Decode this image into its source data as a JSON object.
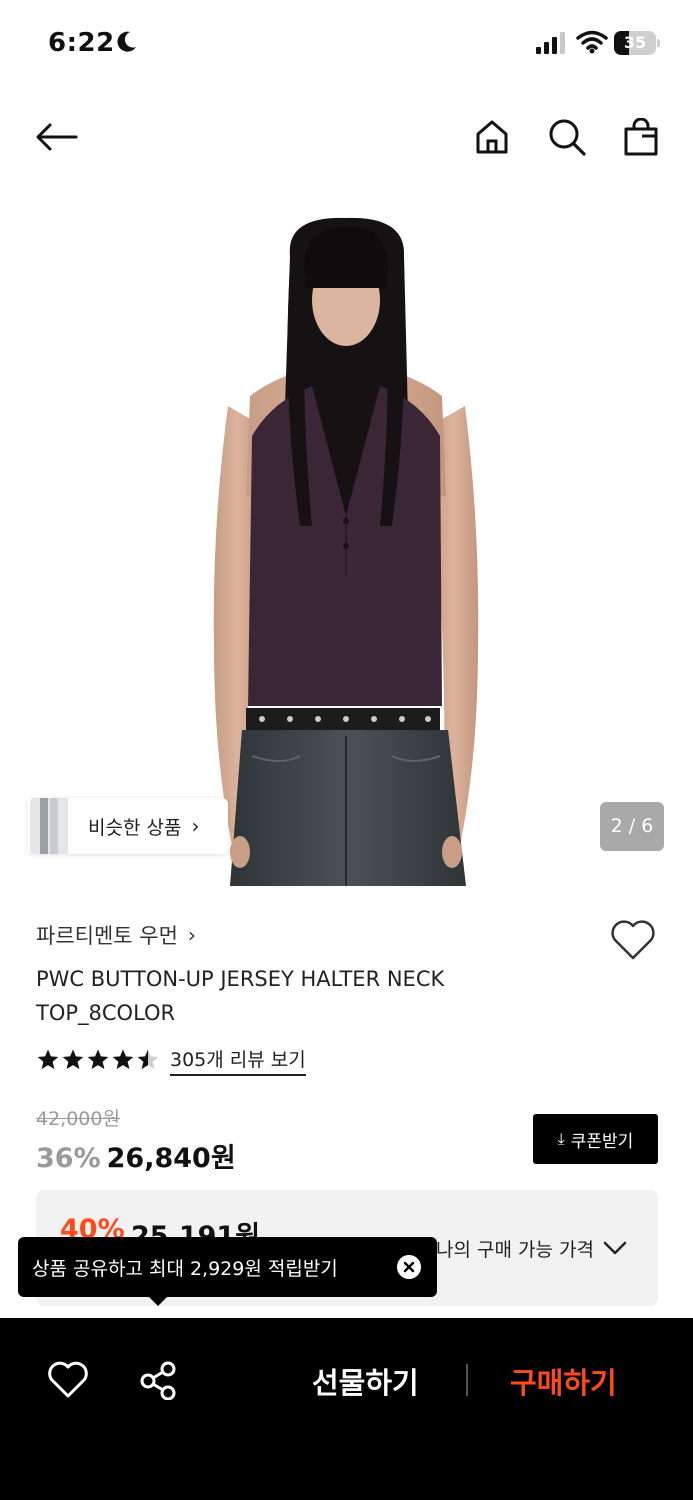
{
  "status_bar": {
    "time": "6:22",
    "battery_text": "35",
    "battery_level": 0.35,
    "icons": [
      "moon-icon",
      "cellular-signal-icon",
      "wifi-icon",
      "battery-icon"
    ]
  },
  "nav": {
    "icons": [
      "back-arrow-icon",
      "home-icon",
      "search-icon",
      "shopping-bag-icon"
    ]
  },
  "gallery": {
    "similar_label": "비슷한 상품",
    "similar_chevron": "›",
    "counter": "2 / 6"
  },
  "product": {
    "brand": "파르티멘토 우먼",
    "brand_chevron": "›",
    "title": "PWC BUTTON-UP JERSEY HALTER NECK TOP_8COLOR",
    "rating": 4.5,
    "max_rating": 5,
    "review_link": "305개 리뷰 보기",
    "original_price": "42,000원",
    "discount": "36%",
    "price": "26,840원",
    "coupon_label": "쿠폰받기",
    "coupon_icon": "⤓",
    "best_discount": "40%",
    "best_price": "25,191원",
    "best_label": "나의 구매 가능 가격"
  },
  "toast": {
    "text": "상품 공유하고 최대 2,929원 적립받기"
  },
  "bottom_bar": {
    "gift_label": "선물하기",
    "buy_label": "구매하기"
  },
  "colors": {
    "accent": "#ff4a1c",
    "top_color": "#3b2638",
    "denim": "#3a4044",
    "counter_bg": "#a9a9a9"
  }
}
